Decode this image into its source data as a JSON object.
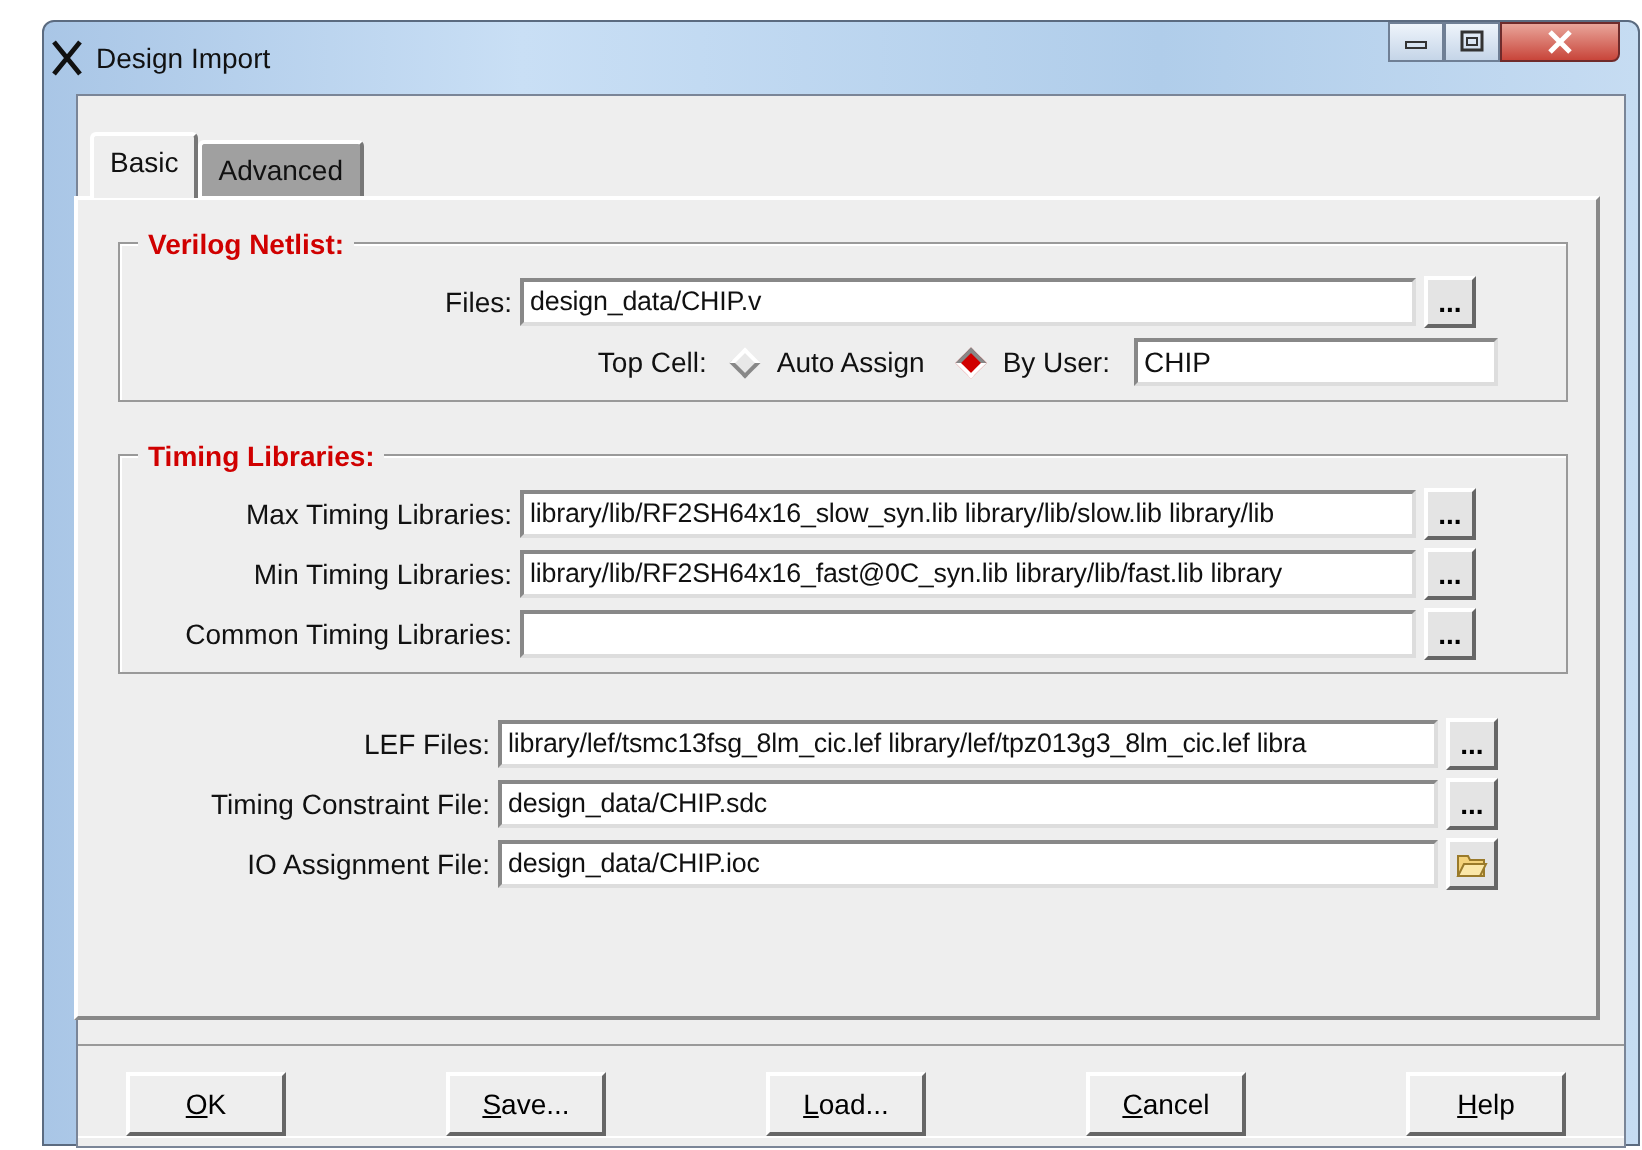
{
  "window": {
    "title": "Design Import"
  },
  "tabs": [
    {
      "label": "Basic",
      "selected": true
    },
    {
      "label": "Advanced",
      "selected": false
    }
  ],
  "verilog_netlist": {
    "title": "Verilog Netlist:",
    "files": {
      "label": "Files:",
      "value": "design_data/CHIP.v",
      "browse": "..."
    },
    "top_cell": {
      "label": "Top Cell:",
      "options": [
        {
          "label": "Auto Assign",
          "selected": false
        },
        {
          "label": "By User:",
          "selected": true
        }
      ],
      "value": "CHIP"
    }
  },
  "timing_libraries": {
    "title": "Timing Libraries:",
    "rows": [
      {
        "label": "Max Timing Libraries:",
        "value": "library/lib/RF2SH64x16_slow_syn.lib library/lib/slow.lib library/lib",
        "browse": "..."
      },
      {
        "label": "Min Timing Libraries:",
        "value": "library/lib/RF2SH64x16_fast@0C_syn.lib library/lib/fast.lib library",
        "browse": "..."
      },
      {
        "label": "Common Timing Libraries:",
        "value": "",
        "browse": "..."
      }
    ]
  },
  "other_files": [
    {
      "label": "LEF Files:",
      "value": "library/lef/tsmc13fsg_8lm_cic.lef library/lef/tpz013g3_8lm_cic.lef libra",
      "kind": "browse",
      "browse": "..."
    },
    {
      "label": "Timing Constraint File:",
      "value": "design_data/CHIP.sdc",
      "kind": "browse",
      "browse": "..."
    },
    {
      "label": "IO Assignment File:",
      "value": "design_data/CHIP.ioc",
      "kind": "folder"
    }
  ],
  "buttons": [
    {
      "label": "OK",
      "mnemonic": true
    },
    {
      "label": "Save...",
      "mnemonic": true
    },
    {
      "label": "Load...",
      "mnemonic": true
    },
    {
      "label": "Cancel",
      "mnemonic": true
    },
    {
      "label": "Help",
      "mnemonic": true
    }
  ]
}
